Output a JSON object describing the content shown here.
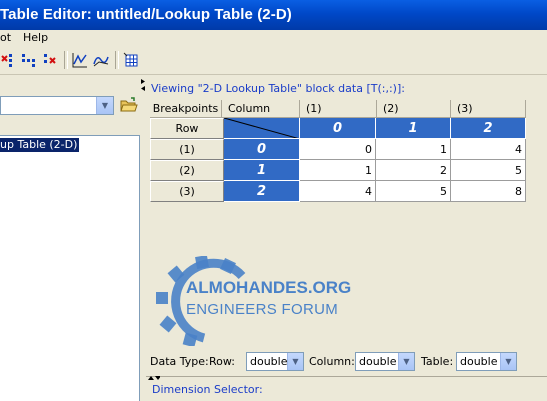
{
  "window": {
    "title": "Table Editor: untitled/Lookup Table (2-D)"
  },
  "menu": {
    "items": [
      "ot",
      "Help"
    ]
  },
  "toolbar": {
    "icons": [
      "delete-column-icon",
      "insert-column-icon",
      "delete-row-icon",
      "plot-icon",
      "plot-mesh-icon",
      "grid-table-icon"
    ]
  },
  "left": {
    "combo_value": "",
    "tree_item": "up Table (2-D)"
  },
  "right": {
    "viewing_text": "Viewing \"2-D Lookup Table\" block data [T(:,:)]:",
    "headers": {
      "breakpoints": "Breakpoints",
      "column": "Column",
      "row": "Row"
    },
    "col_headers": [
      "(1)",
      "(2)",
      "(3)"
    ],
    "row_headers": [
      "(1)",
      "(2)",
      "(3)"
    ],
    "col_breakpoints": [
      "0",
      "1",
      "2"
    ],
    "row_breakpoints": [
      "0",
      "1",
      "2"
    ],
    "values": [
      [
        "0",
        "1",
        "4"
      ],
      [
        "1",
        "2",
        "5"
      ],
      [
        "4",
        "5",
        "8"
      ]
    ]
  },
  "watermark": {
    "line1": "ALMOHANDES.ORG",
    "line2": "ENGINEERS FORUM"
  },
  "data_type": {
    "label": "Data Type:",
    "row_label": "Row:",
    "row_value": "double",
    "column_label": "Column:",
    "column_value": "double",
    "table_label": "Table:",
    "table_value": "double"
  },
  "dimension_selector": "Dimension Selector:",
  "colors": {
    "accent_blue": "#316ac5",
    "title_blue": "#0054e3",
    "link_blue": "#1a3cc8"
  }
}
